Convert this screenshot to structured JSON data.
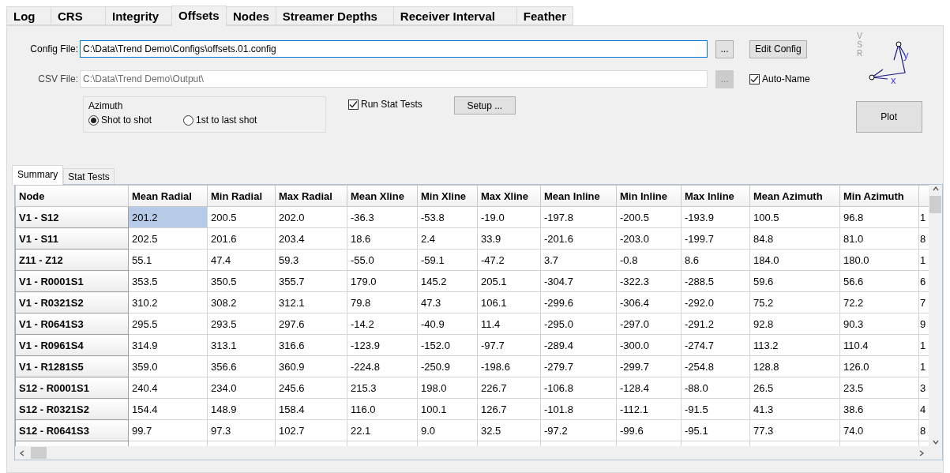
{
  "tabs": [
    {
      "label": "Log",
      "selected": false
    },
    {
      "label": "CRS",
      "selected": false
    },
    {
      "label": "Integrity",
      "selected": false
    },
    {
      "label": "Offsets",
      "selected": true
    },
    {
      "label": "Nodes",
      "selected": false
    },
    {
      "label": "Streamer Depths",
      "selected": false
    },
    {
      "label": "Receiver Interval",
      "selected": false
    },
    {
      "label": "Feather",
      "selected": false
    }
  ],
  "config_file": {
    "label": "Config File:",
    "value": "C:\\Data\\Trend Demo\\Configs\\offsets.01.config",
    "browse": "...",
    "disabled": false
  },
  "csv_file": {
    "label": "CSV File:",
    "value": "C:\\Data\\Trend Demo\\Output\\",
    "browse": "...",
    "disabled": true
  },
  "edit_config": "Edit Config",
  "auto_name": {
    "label": "Auto-Name",
    "checked": true
  },
  "azimuth": {
    "title": "Azimuth",
    "options": [
      {
        "label": "Shot to shot",
        "selected": true
      },
      {
        "label": "1st to last shot",
        "selected": false
      }
    ]
  },
  "run_stat_tests": {
    "label": "Run Stat Tests",
    "checked": true
  },
  "setup": "Setup ...",
  "plot": "Plot",
  "compass": {
    "vsr": "VSR",
    "x": "x",
    "y": "y"
  },
  "subtabs": [
    {
      "label": "Summary",
      "selected": true
    },
    {
      "label": "Stat Tests",
      "selected": false
    }
  ],
  "table": {
    "columns": [
      "Node",
      "Mean Radial",
      "Min Radial",
      "Max Radial",
      "Mean Xline",
      "Min Xline",
      "Max Xline",
      "Mean Inline",
      "Min Inline",
      "Max Inline",
      "Mean Azimuth",
      "Min Azimuth"
    ],
    "rows": [
      {
        "node": "V1 - S12",
        "values": [
          "201.2",
          "200.5",
          "202.0",
          "-36.3",
          "-53.8",
          "-19.0",
          "-197.8",
          "-200.5",
          "-193.9",
          "100.5",
          "96.8",
          "1"
        ],
        "selected": [
          true,
          false,
          false,
          false,
          false,
          false,
          false,
          false,
          false,
          false,
          false,
          false
        ]
      },
      {
        "node": "V1 - S11",
        "values": [
          "202.5",
          "201.6",
          "203.4",
          "18.6",
          "2.4",
          "33.9",
          "-201.6",
          "-203.0",
          "-199.7",
          "84.8",
          "81.0",
          "8"
        ],
        "selected": [
          false,
          false,
          false,
          false,
          false,
          false,
          false,
          false,
          false,
          false,
          false,
          false
        ]
      },
      {
        "node": "Z11 - Z12",
        "values": [
          "55.1",
          "47.4",
          "59.3",
          "-55.0",
          "-59.1",
          "-47.2",
          "3.7",
          "-0.8",
          "8.6",
          "184.0",
          "180.0",
          "1"
        ],
        "selected": [
          false,
          false,
          false,
          false,
          false,
          false,
          false,
          false,
          false,
          false,
          false,
          false
        ]
      },
      {
        "node": "V1 - R0001S1",
        "values": [
          "353.5",
          "350.5",
          "355.7",
          "179.0",
          "145.2",
          "205.1",
          "-304.7",
          "-322.3",
          "-288.5",
          "59.6",
          "56.6",
          "6"
        ],
        "selected": [
          false,
          false,
          false,
          false,
          false,
          false,
          false,
          false,
          false,
          false,
          false,
          false
        ]
      },
      {
        "node": "V1 - R0321S2",
        "values": [
          "310.2",
          "308.2",
          "312.1",
          "79.8",
          "47.3",
          "106.1",
          "-299.6",
          "-306.4",
          "-292.0",
          "75.2",
          "72.2",
          "7"
        ],
        "selected": [
          false,
          false,
          false,
          false,
          false,
          false,
          false,
          false,
          false,
          false,
          false,
          false
        ]
      },
      {
        "node": "V1 - R0641S3",
        "values": [
          "295.5",
          "293.5",
          "297.6",
          "-14.2",
          "-40.9",
          "11.4",
          "-295.0",
          "-297.0",
          "-291.2",
          "92.8",
          "90.3",
          "9"
        ],
        "selected": [
          false,
          false,
          false,
          false,
          false,
          false,
          false,
          false,
          false,
          false,
          false,
          false
        ]
      },
      {
        "node": "V1 - R0961S4",
        "values": [
          "314.9",
          "313.1",
          "316.6",
          "-123.9",
          "-152.0",
          "-97.7",
          "-289.4",
          "-300.0",
          "-274.7",
          "113.2",
          "110.4",
          "1"
        ],
        "selected": [
          false,
          false,
          false,
          false,
          false,
          false,
          false,
          false,
          false,
          false,
          false,
          false
        ]
      },
      {
        "node": "V1 - R1281S5",
        "values": [
          "359.0",
          "356.6",
          "360.9",
          "-224.8",
          "-250.9",
          "-198.6",
          "-279.7",
          "-299.7",
          "-254.8",
          "128.8",
          "126.0",
          "1"
        ],
        "selected": [
          false,
          false,
          false,
          false,
          false,
          false,
          false,
          false,
          false,
          false,
          false,
          false
        ]
      },
      {
        "node": "S12 - R0001S1",
        "values": [
          "240.4",
          "234.0",
          "245.6",
          "215.3",
          "198.0",
          "226.7",
          "-106.8",
          "-128.4",
          "-88.0",
          "26.5",
          "23.5",
          "3"
        ],
        "selected": [
          false,
          false,
          false,
          false,
          false,
          false,
          false,
          false,
          false,
          false,
          false,
          false
        ]
      },
      {
        "node": "S12 - R0321S2",
        "values": [
          "154.4",
          "148.9",
          "158.4",
          "116.0",
          "100.1",
          "126.7",
          "-101.8",
          "-112.1",
          "-91.5",
          "41.3",
          "38.6",
          "4"
        ],
        "selected": [
          false,
          false,
          false,
          false,
          false,
          false,
          false,
          false,
          false,
          false,
          false,
          false
        ]
      },
      {
        "node": "S12 - R0641S3",
        "values": [
          "99.7",
          "97.3",
          "102.7",
          "22.1",
          "9.0",
          "32.5",
          "-97.2",
          "-99.6",
          "-95.1",
          "77.3",
          "74.0",
          "8"
        ],
        "selected": [
          false,
          false,
          false,
          false,
          false,
          false,
          false,
          false,
          false,
          false,
          false,
          false
        ]
      }
    ]
  }
}
